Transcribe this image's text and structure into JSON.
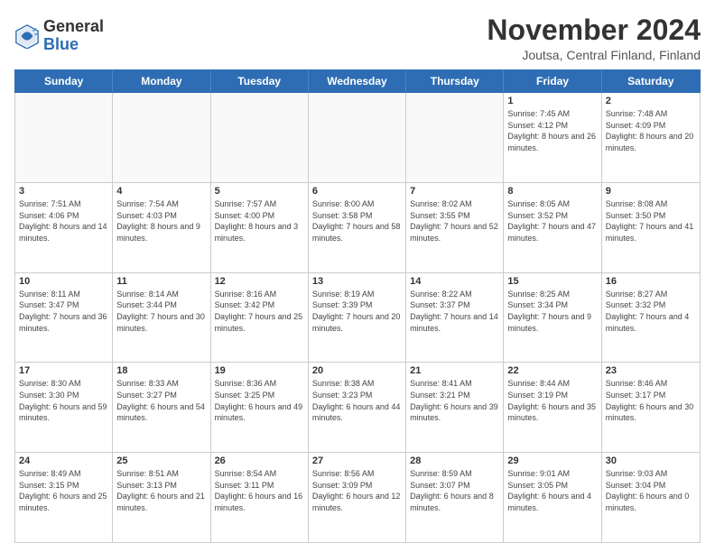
{
  "logo": {
    "general": "General",
    "blue": "Blue"
  },
  "title": "November 2024",
  "subtitle": "Joutsa, Central Finland, Finland",
  "days_of_week": [
    "Sunday",
    "Monday",
    "Tuesday",
    "Wednesday",
    "Thursday",
    "Friday",
    "Saturday"
  ],
  "rows": [
    [
      {
        "day": "",
        "info": ""
      },
      {
        "day": "",
        "info": ""
      },
      {
        "day": "",
        "info": ""
      },
      {
        "day": "",
        "info": ""
      },
      {
        "day": "",
        "info": ""
      },
      {
        "day": "1",
        "info": "Sunrise: 7:45 AM\nSunset: 4:12 PM\nDaylight: 8 hours and 26 minutes."
      },
      {
        "day": "2",
        "info": "Sunrise: 7:48 AM\nSunset: 4:09 PM\nDaylight: 8 hours and 20 minutes."
      }
    ],
    [
      {
        "day": "3",
        "info": "Sunrise: 7:51 AM\nSunset: 4:06 PM\nDaylight: 8 hours and 14 minutes."
      },
      {
        "day": "4",
        "info": "Sunrise: 7:54 AM\nSunset: 4:03 PM\nDaylight: 8 hours and 9 minutes."
      },
      {
        "day": "5",
        "info": "Sunrise: 7:57 AM\nSunset: 4:00 PM\nDaylight: 8 hours and 3 minutes."
      },
      {
        "day": "6",
        "info": "Sunrise: 8:00 AM\nSunset: 3:58 PM\nDaylight: 7 hours and 58 minutes."
      },
      {
        "day": "7",
        "info": "Sunrise: 8:02 AM\nSunset: 3:55 PM\nDaylight: 7 hours and 52 minutes."
      },
      {
        "day": "8",
        "info": "Sunrise: 8:05 AM\nSunset: 3:52 PM\nDaylight: 7 hours and 47 minutes."
      },
      {
        "day": "9",
        "info": "Sunrise: 8:08 AM\nSunset: 3:50 PM\nDaylight: 7 hours and 41 minutes."
      }
    ],
    [
      {
        "day": "10",
        "info": "Sunrise: 8:11 AM\nSunset: 3:47 PM\nDaylight: 7 hours and 36 minutes."
      },
      {
        "day": "11",
        "info": "Sunrise: 8:14 AM\nSunset: 3:44 PM\nDaylight: 7 hours and 30 minutes."
      },
      {
        "day": "12",
        "info": "Sunrise: 8:16 AM\nSunset: 3:42 PM\nDaylight: 7 hours and 25 minutes."
      },
      {
        "day": "13",
        "info": "Sunrise: 8:19 AM\nSunset: 3:39 PM\nDaylight: 7 hours and 20 minutes."
      },
      {
        "day": "14",
        "info": "Sunrise: 8:22 AM\nSunset: 3:37 PM\nDaylight: 7 hours and 14 minutes."
      },
      {
        "day": "15",
        "info": "Sunrise: 8:25 AM\nSunset: 3:34 PM\nDaylight: 7 hours and 9 minutes."
      },
      {
        "day": "16",
        "info": "Sunrise: 8:27 AM\nSunset: 3:32 PM\nDaylight: 7 hours and 4 minutes."
      }
    ],
    [
      {
        "day": "17",
        "info": "Sunrise: 8:30 AM\nSunset: 3:30 PM\nDaylight: 6 hours and 59 minutes."
      },
      {
        "day": "18",
        "info": "Sunrise: 8:33 AM\nSunset: 3:27 PM\nDaylight: 6 hours and 54 minutes."
      },
      {
        "day": "19",
        "info": "Sunrise: 8:36 AM\nSunset: 3:25 PM\nDaylight: 6 hours and 49 minutes."
      },
      {
        "day": "20",
        "info": "Sunrise: 8:38 AM\nSunset: 3:23 PM\nDaylight: 6 hours and 44 minutes."
      },
      {
        "day": "21",
        "info": "Sunrise: 8:41 AM\nSunset: 3:21 PM\nDaylight: 6 hours and 39 minutes."
      },
      {
        "day": "22",
        "info": "Sunrise: 8:44 AM\nSunset: 3:19 PM\nDaylight: 6 hours and 35 minutes."
      },
      {
        "day": "23",
        "info": "Sunrise: 8:46 AM\nSunset: 3:17 PM\nDaylight: 6 hours and 30 minutes."
      }
    ],
    [
      {
        "day": "24",
        "info": "Sunrise: 8:49 AM\nSunset: 3:15 PM\nDaylight: 6 hours and 25 minutes."
      },
      {
        "day": "25",
        "info": "Sunrise: 8:51 AM\nSunset: 3:13 PM\nDaylight: 6 hours and 21 minutes."
      },
      {
        "day": "26",
        "info": "Sunrise: 8:54 AM\nSunset: 3:11 PM\nDaylight: 6 hours and 16 minutes."
      },
      {
        "day": "27",
        "info": "Sunrise: 8:56 AM\nSunset: 3:09 PM\nDaylight: 6 hours and 12 minutes."
      },
      {
        "day": "28",
        "info": "Sunrise: 8:59 AM\nSunset: 3:07 PM\nDaylight: 6 hours and 8 minutes."
      },
      {
        "day": "29",
        "info": "Sunrise: 9:01 AM\nSunset: 3:05 PM\nDaylight: 6 hours and 4 minutes."
      },
      {
        "day": "30",
        "info": "Sunrise: 9:03 AM\nSunset: 3:04 PM\nDaylight: 6 hours and 0 minutes."
      }
    ]
  ]
}
